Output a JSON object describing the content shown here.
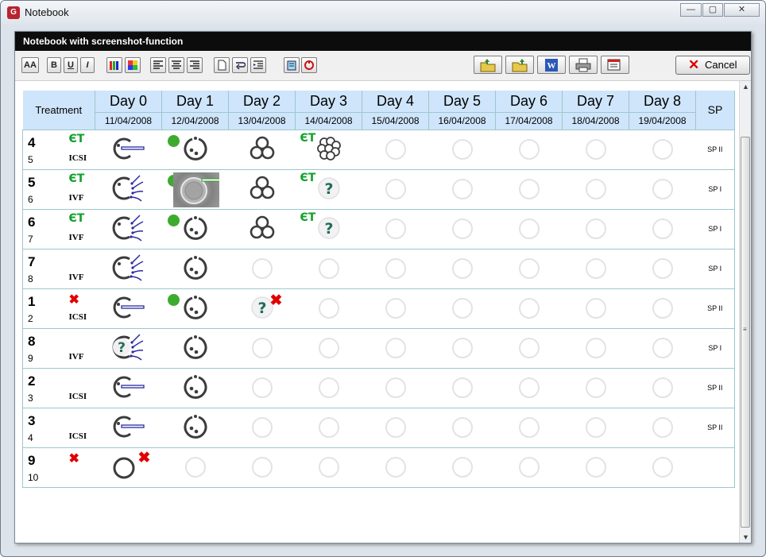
{
  "window": {
    "title": "Notebook",
    "minimize": "—",
    "maximize": "▢",
    "close": "✕"
  },
  "panel": {
    "header": "Notebook with screenshot-function"
  },
  "toolbar": {
    "font_btn": "AA",
    "bold": "B",
    "underline": "U",
    "italic": "I",
    "cancel": "Cancel"
  },
  "table": {
    "treatment_header": "Treatment",
    "sp_header": "SP",
    "days": [
      {
        "name": "Day 0",
        "date": "11/04/2008"
      },
      {
        "name": "Day 1",
        "date": "12/04/2008"
      },
      {
        "name": "Day 2",
        "date": "13/04/2008"
      },
      {
        "name": "Day 3",
        "date": "14/04/2008"
      },
      {
        "name": "Day 4",
        "date": "15/04/2008"
      },
      {
        "name": "Day 5",
        "date": "16/04/2008"
      },
      {
        "name": "Day 6",
        "date": "17/04/2008"
      },
      {
        "name": "Day 7",
        "date": "18/04/2008"
      },
      {
        "name": "Day 8",
        "date": "19/04/2008"
      }
    ],
    "rows": [
      {
        "num": "4",
        "sub": "5",
        "et": "ЄT",
        "method": "ICSI",
        "sp": "SP II",
        "cancelled": false,
        "cells": [
          "icsi-oocyte",
          "dot+pronuclear",
          "2pn-3cell",
          "et+morula",
          "empty",
          "empty",
          "empty",
          "empty",
          "empty"
        ]
      },
      {
        "num": "5",
        "sub": "6",
        "et": "ЄT",
        "method": "IVF",
        "sp": "SP I",
        "cancelled": false,
        "cells": [
          "ivf-oocyte",
          "dot+photo",
          "2pn-3cell",
          "et+question",
          "empty",
          "empty",
          "empty",
          "empty",
          "empty"
        ]
      },
      {
        "num": "6",
        "sub": "7",
        "et": "ЄT",
        "method": "IVF",
        "sp": "SP I",
        "cancelled": false,
        "cells": [
          "ivf-oocyte",
          "dot+pronuclear",
          "2pn-3cell",
          "et+question",
          "empty",
          "empty",
          "empty",
          "empty",
          "empty"
        ]
      },
      {
        "num": "7",
        "sub": "8",
        "et": "",
        "method": "IVF",
        "sp": "SP I",
        "cancelled": false,
        "cells": [
          "ivf-oocyte",
          "pronuclear",
          "empty",
          "empty",
          "empty",
          "empty",
          "empty",
          "empty",
          "empty"
        ]
      },
      {
        "num": "1",
        "sub": "2",
        "et": "",
        "method": "ICSI",
        "sp": "SP II",
        "cancelled": true,
        "cells": [
          "icsi-oocyte",
          "dot+pronuclear",
          "question+x",
          "empty",
          "empty",
          "empty",
          "empty",
          "empty",
          "empty"
        ]
      },
      {
        "num": "8",
        "sub": "9",
        "et": "",
        "method": "IVF",
        "sp": "SP I",
        "cancelled": false,
        "cells": [
          "ivf-question",
          "pronuclear",
          "empty",
          "empty",
          "empty",
          "empty",
          "empty",
          "empty",
          "empty"
        ]
      },
      {
        "num": "2",
        "sub": "3",
        "et": "",
        "method": "ICSI",
        "sp": "SP II",
        "cancelled": false,
        "cells": [
          "icsi-oocyte",
          "pronuclear",
          "empty",
          "empty",
          "empty",
          "empty",
          "empty",
          "empty",
          "empty"
        ]
      },
      {
        "num": "3",
        "sub": "4",
        "et": "",
        "method": "ICSI",
        "sp": "SP II",
        "cancelled": false,
        "cells": [
          "icsi-oocyte",
          "pronuclear",
          "empty",
          "empty",
          "empty",
          "empty",
          "empty",
          "empty",
          "empty"
        ]
      },
      {
        "num": "9",
        "sub": "10",
        "et": "",
        "method": "",
        "sp": "",
        "cancelled": true,
        "cells": [
          "oocyte+x",
          "empty",
          "empty",
          "empty",
          "empty",
          "empty",
          "empty",
          "empty",
          "empty"
        ]
      }
    ]
  },
  "colors": {
    "header_bg": "#cfe5fb",
    "grid_line": "#9bc8cc",
    "et_green": "#13a02e",
    "cancel_red": "#e00000",
    "dot_green": "#3dab2e",
    "embryo_dark": "#3c3c3c",
    "question_teal": "#1f6b5a"
  }
}
